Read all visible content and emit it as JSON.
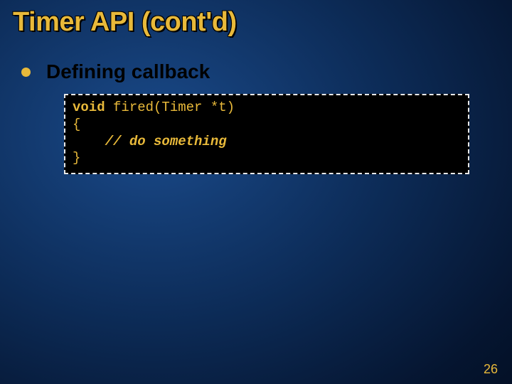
{
  "slide": {
    "title": "Timer API (cont'd)",
    "bullet": "Defining callback",
    "code": {
      "line1_kw": "void",
      "line1_rest": " fired(Timer *t)",
      "line2": "{",
      "line3_indent": "    ",
      "line3_comment": "// do something",
      "line4": "}"
    },
    "page_number": "26"
  }
}
